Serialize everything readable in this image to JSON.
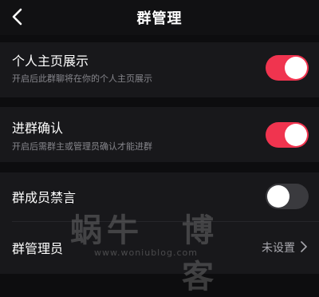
{
  "header": {
    "title": "群管理",
    "back_icon": "chevron-left-icon"
  },
  "settings": {
    "profile_display": {
      "title": "个人主页展示",
      "description": "开启后此群聊将在你的个人主页展示",
      "enabled": true
    },
    "join_confirm": {
      "title": "进群确认",
      "description": "开启后需群主或管理员确认才能进群",
      "enabled": true
    },
    "member_mute": {
      "title": "群成员禁言",
      "enabled": false
    },
    "admins": {
      "title": "群管理员",
      "value": "未设置",
      "icon": "chevron-right-icon"
    }
  },
  "watermark": {
    "text_left": "蜗牛",
    "text_right": "博客",
    "url": "www.woniublog.com"
  },
  "colors": {
    "accent": "#f0344f",
    "background": "#0d0d0f",
    "section": "#18181b"
  }
}
